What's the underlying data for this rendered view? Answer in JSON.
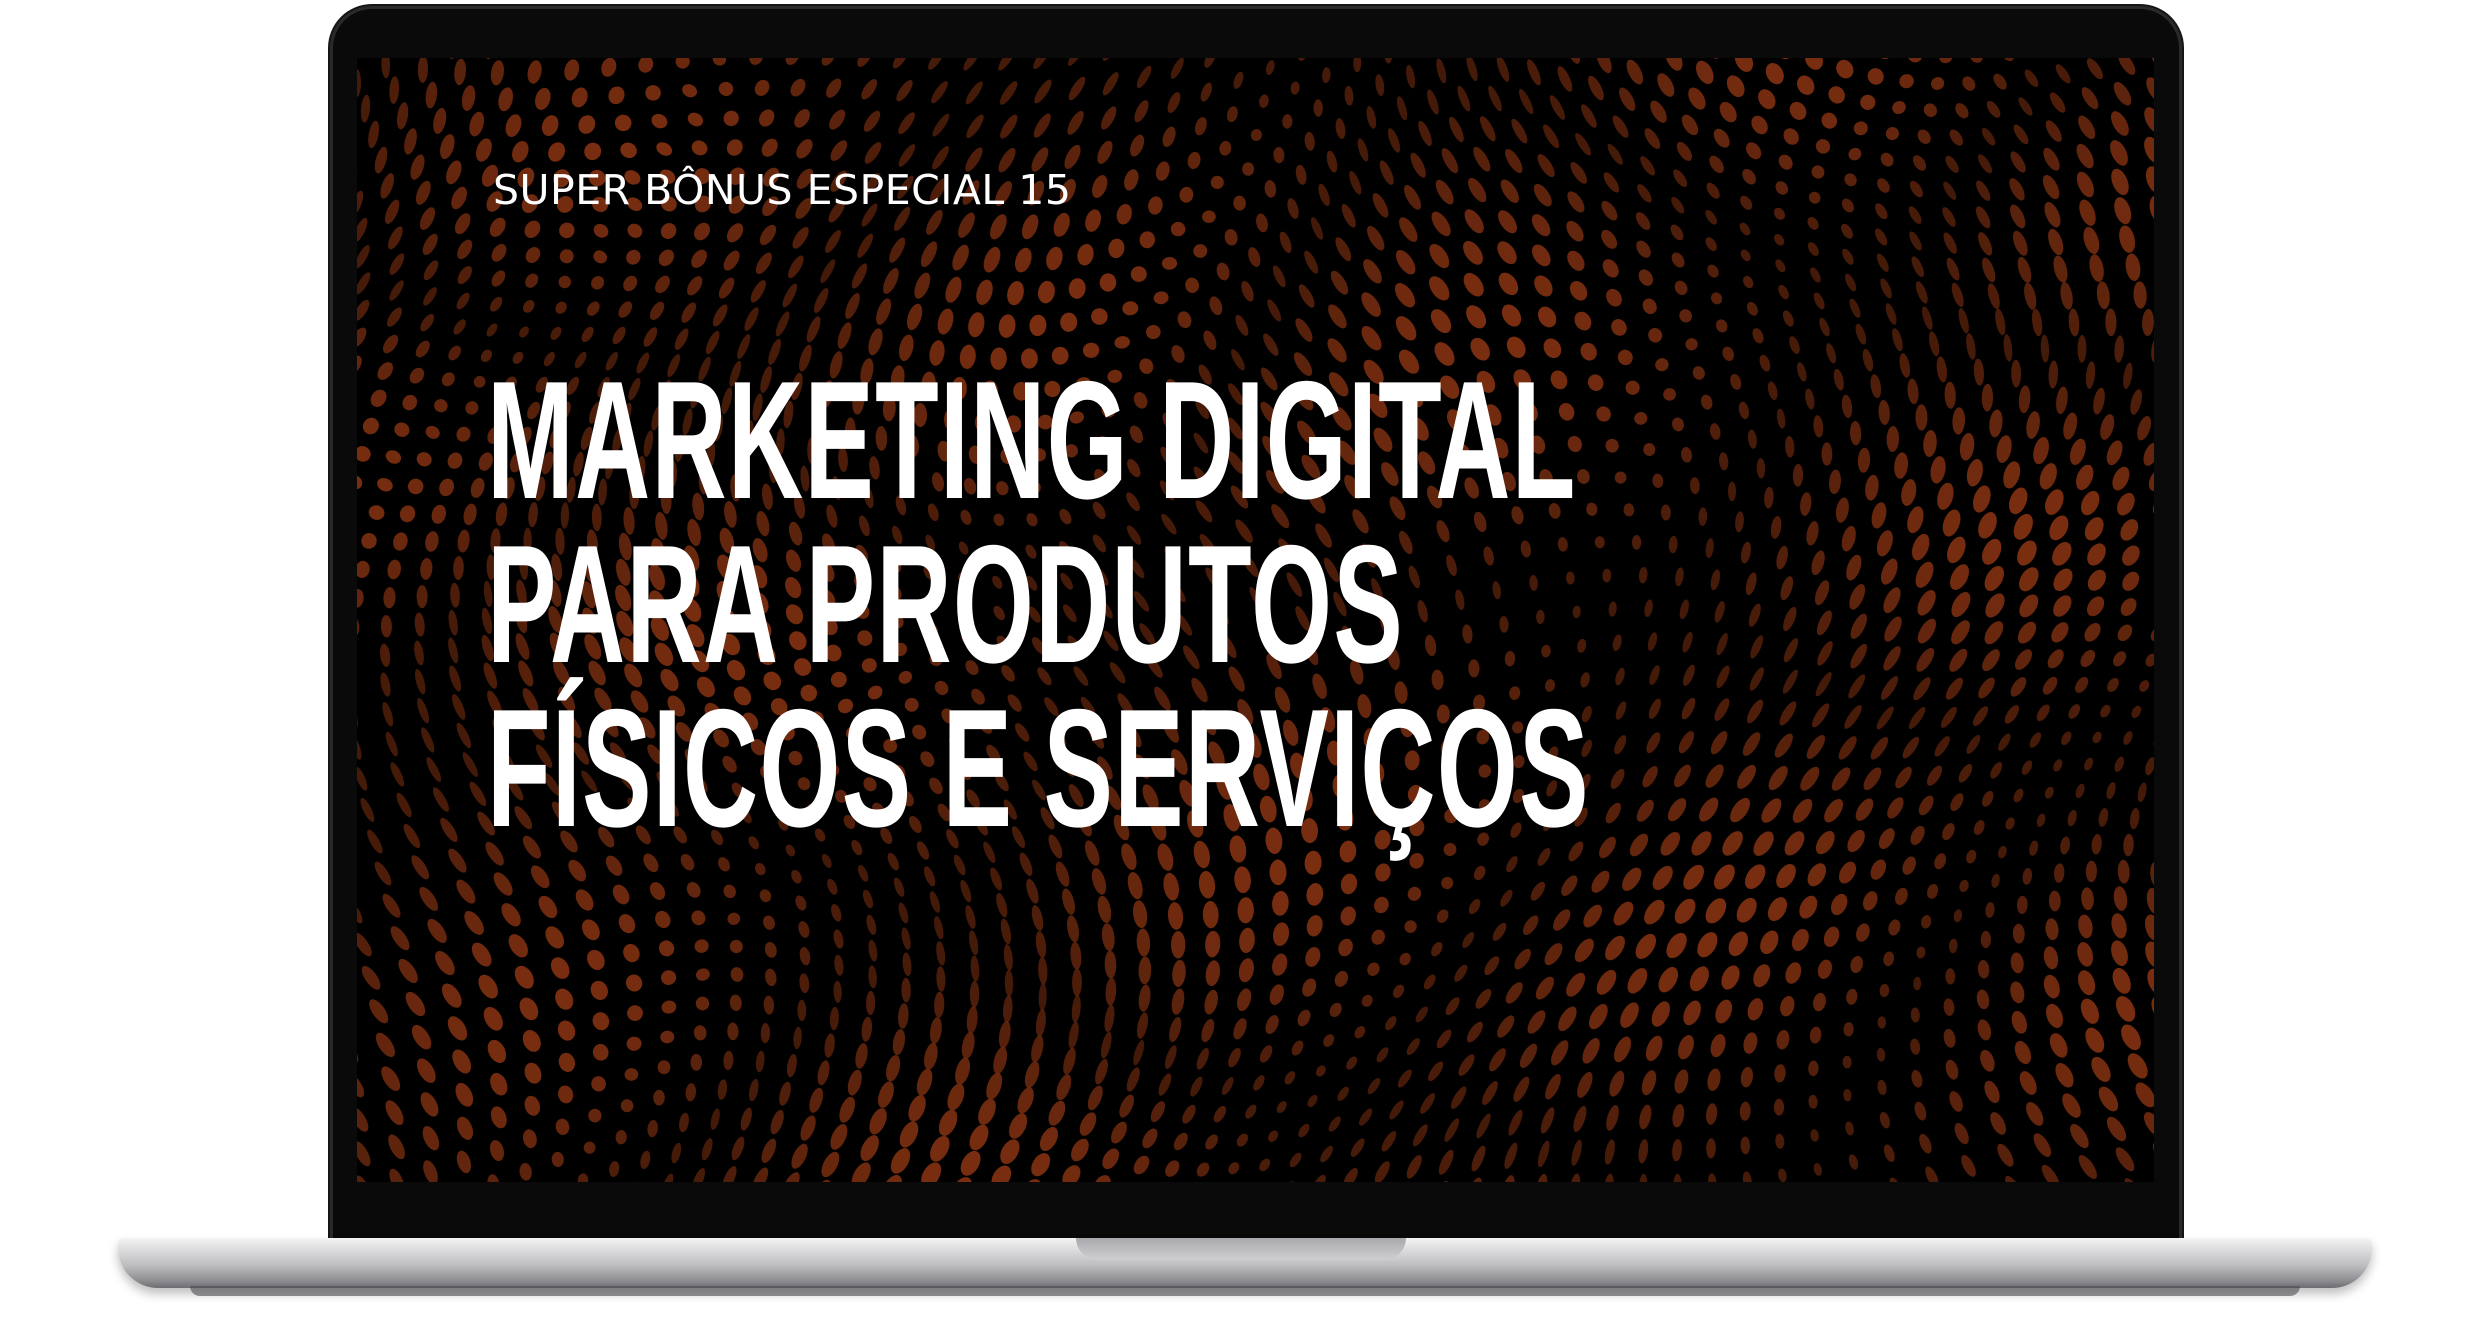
{
  "screen": {
    "bonus_label": "SUPER BÔNUS ESPECIAL 15",
    "headline_lines": [
      "MARKETING DIGITAL",
      "PARA PRODUTOS",
      "FÍSICOS E SERVIÇOS"
    ],
    "background_color": "#000000",
    "dot_color": "#7a2e10",
    "text_color": "#ffffff"
  },
  "device": {
    "type": "laptop",
    "bezel_color": "#0a0a0a",
    "body_color": "#c4c4c7"
  }
}
